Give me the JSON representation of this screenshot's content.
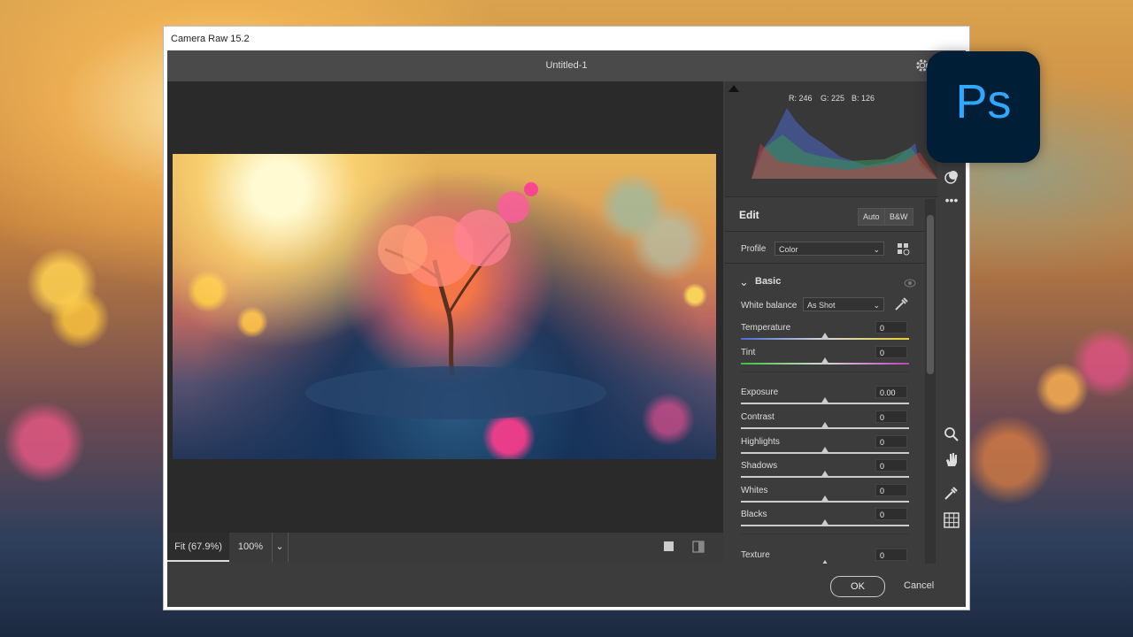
{
  "window": {
    "title": "Camera Raw 15.2"
  },
  "header": {
    "document_title": "Untitled-1"
  },
  "histogram": {
    "r": "R: 246",
    "g": "G: 225",
    "b": "B: 126"
  },
  "edit": {
    "title": "Edit",
    "auto_label": "Auto",
    "bw_label": "B&W",
    "profile_label": "Profile",
    "profile_value": "Color"
  },
  "basic": {
    "section_title": "Basic",
    "white_balance_label": "White balance",
    "white_balance_value": "As Shot",
    "sliders": [
      {
        "label": "Temperature",
        "value": "0",
        "level": 0.5
      },
      {
        "label": "Tint",
        "value": "0",
        "level": 0.5
      },
      {
        "label": "Exposure",
        "value": "0.00",
        "level": 0.5
      },
      {
        "label": "Contrast",
        "value": "0",
        "level": 0.5
      },
      {
        "label": "Highlights",
        "value": "0",
        "level": 0.5
      },
      {
        "label": "Shadows",
        "value": "0",
        "level": 0.5
      },
      {
        "label": "Whites",
        "value": "0",
        "level": 0.5
      },
      {
        "label": "Blacks",
        "value": "0",
        "level": 0.5
      },
      {
        "label": "Texture",
        "value": "0",
        "level": 0.5
      }
    ]
  },
  "zoom": {
    "fit_label": "Fit (67.9%)",
    "hundred_label": "100%"
  },
  "footer": {
    "ok_label": "OK",
    "cancel_label": "Cancel"
  },
  "badge": {
    "text": "Ps"
  },
  "icons": [
    "gear-icon",
    "clip-warning-icon",
    "eye-icon",
    "masking-icon",
    "more-icon",
    "zoom-icon",
    "hand-icon",
    "color-sampler-icon",
    "grid-icon",
    "profile-browser-icon",
    "eyedropper-icon",
    "visibility-icon",
    "collapse-chevron-icon",
    "single-view-icon",
    "before-after-icon"
  ],
  "colors": {
    "accent": "#31a8ff",
    "badge_bg": "#001e36",
    "panel_bg": "#3c3c3c"
  }
}
